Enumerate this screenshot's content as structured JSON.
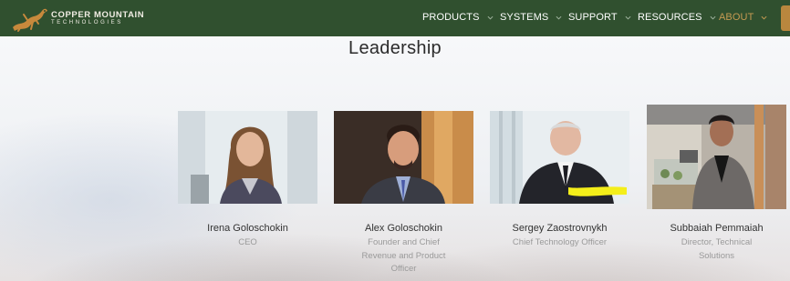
{
  "brand": {
    "line1": "COPPER MOUNTAIN",
    "line2": "TECHNOLOGIES"
  },
  "nav": {
    "items": [
      {
        "label": "PRODUCTS",
        "name": "nav-products"
      },
      {
        "label": "SYSTEMS",
        "name": "nav-systems"
      },
      {
        "label": "SUPPORT",
        "name": "nav-support"
      },
      {
        "label": "RESOURCES",
        "name": "nav-resources"
      },
      {
        "label": "ABOUT",
        "name": "nav-about",
        "active": true
      }
    ],
    "active_color": "#c59a52",
    "bar_color": "#30502f"
  },
  "section": {
    "title": "Leadership"
  },
  "people": [
    {
      "name": "Irena Goloschokin",
      "role": "CEO"
    },
    {
      "name": "Alex Goloschokin",
      "role": "Founder and Chief Revenue and Product Officer"
    },
    {
      "name": "Sergey Zaostrovnykh",
      "role": "Chief Technology Officer"
    },
    {
      "name": "Subbaiah Pemmaiah",
      "role": "Director, Technical Solutions"
    }
  ]
}
